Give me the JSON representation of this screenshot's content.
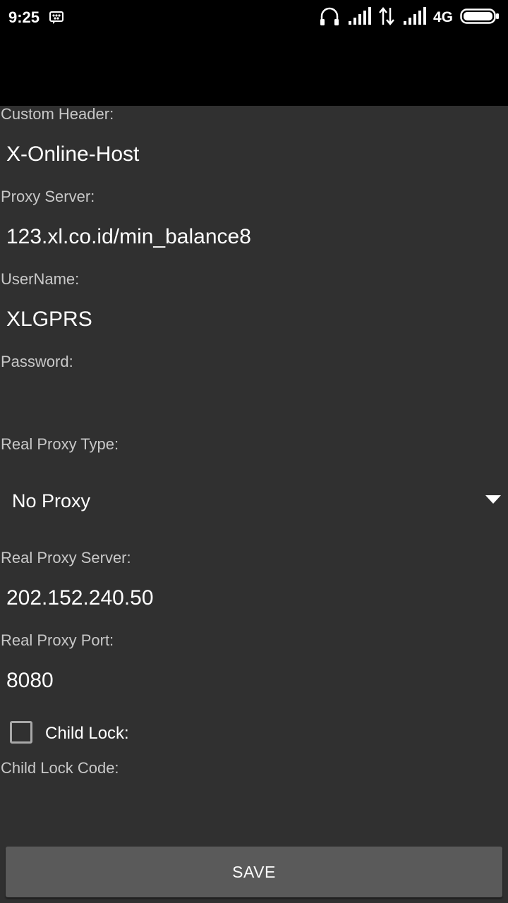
{
  "status_bar": {
    "time": "9:25",
    "network_type": "4G",
    "icons": [
      "bbm-notification-icon",
      "headset-icon",
      "signal-icon",
      "data-transfer-icon",
      "signal-icon",
      "battery-icon"
    ]
  },
  "form": {
    "custom_header": {
      "label": "Custom Header:",
      "value": "X-Online-Host"
    },
    "proxy_server": {
      "label": "Proxy Server:",
      "value": "123.xl.co.id/min_balance8"
    },
    "username": {
      "label": "UserName:",
      "value": "XLGPRS"
    },
    "password": {
      "label": "Password:",
      "value": ""
    },
    "real_proxy_type": {
      "label": "Real Proxy Type:",
      "selected": "No Proxy"
    },
    "real_proxy_server": {
      "label": "Real Proxy Server:",
      "value": "202.152.240.50"
    },
    "real_proxy_port": {
      "label": "Real Proxy Port:",
      "value": "8080"
    },
    "child_lock": {
      "label": "Child Lock:",
      "checked": false
    },
    "child_lock_code": {
      "label": "Child Lock Code:",
      "value": ""
    }
  },
  "save_button": {
    "label": "SAVE"
  },
  "colors": {
    "background": "#303030",
    "status_bar": "#000000",
    "label_text": "#c8c8c8",
    "value_text": "#ffffff",
    "button_bg": "#5a5a5a"
  }
}
